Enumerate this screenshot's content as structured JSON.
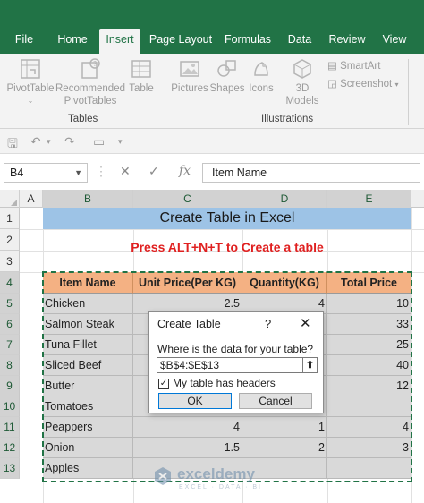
{
  "ribbon_tabs": [
    "File",
    "Home",
    "Insert",
    "Page Layout",
    "Formulas",
    "Data",
    "Review",
    "View"
  ],
  "active_tab": "Insert",
  "ribbon": {
    "pivottable": "PivotTable",
    "recommended_1": "Recommended",
    "recommended_2": "PivotTables",
    "table": "Table",
    "group_tables": "Tables",
    "pictures": "Pictures",
    "shapes": "Shapes",
    "icons": "Icons",
    "models_1": "3D",
    "models_2": "Models",
    "smartart": "SmartArt",
    "screenshot": "Screenshot",
    "group_illustrations": "Illustrations"
  },
  "formula_bar": {
    "name_box": "B4",
    "fx": "fx",
    "content": "Item Name"
  },
  "columns": [
    "A",
    "B",
    "C",
    "D",
    "E"
  ],
  "rows": [
    "1",
    "2",
    "3",
    "4",
    "5",
    "6",
    "7",
    "8",
    "9",
    "10",
    "11",
    "12",
    "13"
  ],
  "sheet": {
    "title": "Create Table in Excel",
    "instruction": "Press ALT+N+T to Create a table",
    "headers": [
      "Item Name",
      "Unit Price(Per KG)",
      "Quantity(KG)",
      "Total Price"
    ],
    "data_rows": [
      [
        "Chicken",
        "2.5",
        "4",
        "10"
      ],
      [
        "Salmon Steak",
        "",
        "",
        "33"
      ],
      [
        "Tuna Fillet",
        "",
        "",
        "25"
      ],
      [
        "Sliced Beef",
        "",
        "",
        "40"
      ],
      [
        "Butter",
        "",
        "",
        "12"
      ],
      [
        "Tomatoes",
        "",
        "",
        ""
      ],
      [
        "Peappers",
        "4",
        "1",
        "4"
      ],
      [
        "Onion",
        "1.5",
        "2",
        "3"
      ],
      [
        "Apples",
        "",
        "",
        ""
      ]
    ]
  },
  "dialog": {
    "title": "Create Table",
    "help": "?",
    "close": "✕",
    "question": "Where is the data for your table?",
    "range": "$B$4:$E$13",
    "collapse": "⬆",
    "check_mark": "✓",
    "headers_label": "My table has headers",
    "ok": "OK",
    "cancel": "Cancel",
    "headers_checked": true
  },
  "watermark": {
    "name": "exceldemy",
    "tagline": "EXCEL · DATA · BI"
  },
  "colors": {
    "excel_green": "#217346",
    "title_fill": "#9dc3e6",
    "header_fill": "#f4b183",
    "cell_fill": "#d9d9d9",
    "instruction_red": "#e02020"
  }
}
